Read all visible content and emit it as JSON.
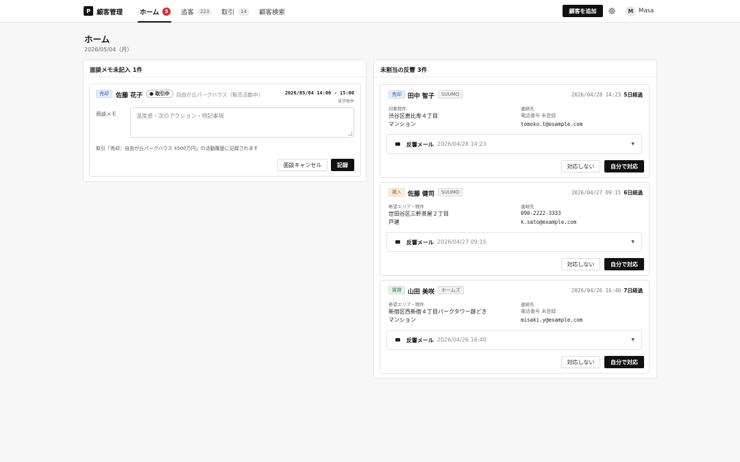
{
  "header": {
    "logo_letter": "P",
    "app_title": "顧客管理",
    "tabs": [
      {
        "label": "ホーム",
        "badge": "5"
      },
      {
        "label": "追客",
        "badge": "223"
      },
      {
        "label": "取引",
        "badge": "14"
      },
      {
        "label": "顧客検索"
      }
    ],
    "add_customer_label": "顧客を追加",
    "avatar_letter": "M",
    "user_name": "Masa"
  },
  "page": {
    "title": "ホーム",
    "date": "2026/05/04（月）"
  },
  "memo_panel": {
    "title": "面談メモ未記入 1件",
    "item": {
      "type_tag": "売却",
      "name": "佐藤 花子",
      "status": "● 取引中",
      "property": "自由が丘パークハウス（販売活動中）",
      "datetime": "2026/05/04 14:00 - 15:00",
      "sub_label": "見学物件",
      "memo_label": "商談メモ",
      "memo_placeholder": "温度感・次のアクション・特記事項",
      "note": "取引「売却：自由が丘パークハウス 4500万円」の活動履歴に記録されます",
      "cancel_label": "面談キャンセル",
      "record_label": "記録"
    }
  },
  "response_panel": {
    "title": "未割当の反響 3件",
    "items": [
      {
        "type_tag": "売却",
        "name": "田中 智子",
        "source": "SUUMO",
        "datetime": "2026/04/28 14:23",
        "elapsed": "5日経過",
        "left_label": "対象物件",
        "left_value_1": "渋谷区恵比寿４丁目",
        "left_value_2": "マンション",
        "right_label": "連絡先",
        "right_value_1": "電話番号 未登録",
        "right_value_2": "tomoko.t@example.com",
        "mail_label": "反響メール",
        "mail_date": "2026/04/28 14:23",
        "decline_label": "対応しない",
        "accept_label": "自分で対応"
      },
      {
        "type_tag": "購入",
        "name": "佐藤 健司",
        "source": "SUUMO",
        "datetime": "2026/04/27 09:15",
        "elapsed": "6日経過",
        "left_label": "希望エリア・物件",
        "left_value_1": "世田谷区三軒茶屋２丁目",
        "left_value_2": "戸建",
        "right_label": "連絡先",
        "right_value_1": "090-2222-3333",
        "right_value_2": "k.sato@example.com",
        "mail_label": "反響メール",
        "mail_date": "2026/04/27 09:15",
        "decline_label": "対応しない",
        "accept_label": "自分で対応"
      },
      {
        "type_tag": "賃貸",
        "name": "山田 美咲",
        "source": "ホームズ",
        "datetime": "2026/04/26 16:40",
        "elapsed": "7日経過",
        "left_label": "希望エリア・物件",
        "left_value_1": "新宿区西新宿４丁目パークタワー跡どき",
        "left_value_2": "マンション",
        "right_label": "連絡先",
        "right_value_1": "電話番号 未登録",
        "right_value_2": "misaki.y@example.com",
        "mail_label": "反響メール",
        "mail_date": "2026/04/26 16:40",
        "decline_label": "対応しない",
        "accept_label": "自分で対応"
      }
    ]
  }
}
